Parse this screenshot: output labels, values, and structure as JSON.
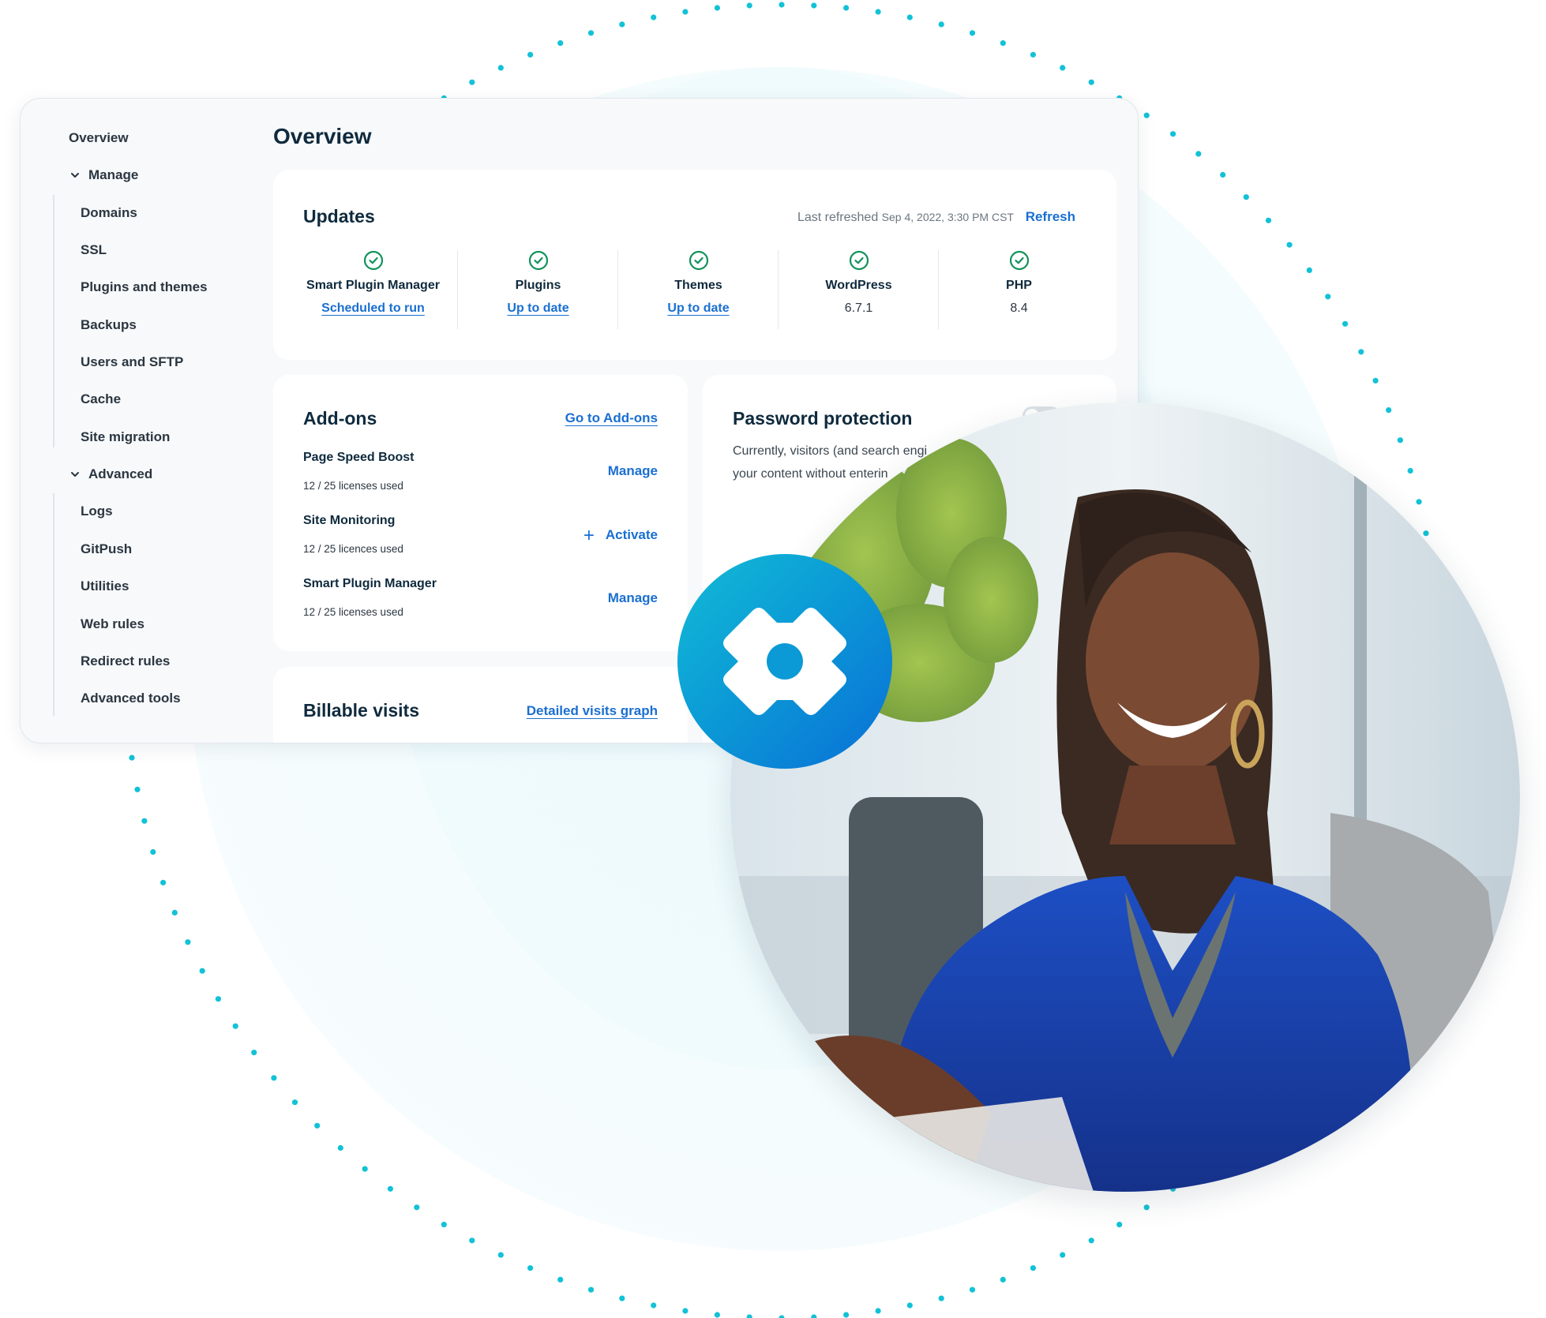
{
  "sidebar": {
    "overview": "Overview",
    "groups": [
      {
        "label": "Manage",
        "items": [
          "Domains",
          "SSL",
          "Plugins and themes",
          "Backups",
          "Users and SFTP",
          "Cache",
          "Site migration"
        ]
      },
      {
        "label": "Advanced",
        "items": [
          "Logs",
          "GitPush",
          "Utilities",
          "Web rules",
          "Redirect rules",
          "Advanced tools"
        ]
      }
    ]
  },
  "main": {
    "title": "Overview",
    "updates": {
      "title": "Updates",
      "last_refreshed_label": "Last refreshed",
      "last_refreshed_time": "Sep 4, 2022, 3:30 PM CST",
      "refresh_label": "Refresh",
      "items": [
        {
          "label": "Smart Plugin Manager",
          "value": "Scheduled to run",
          "is_link": true
        },
        {
          "label": "Plugins",
          "value": "Up to date",
          "is_link": true
        },
        {
          "label": "Themes",
          "value": "Up to date",
          "is_link": true
        },
        {
          "label": "WordPress",
          "value": "6.7.1",
          "is_link": false
        },
        {
          "label": "PHP",
          "value": "8.4",
          "is_link": false
        }
      ]
    },
    "addons": {
      "title": "Add-ons",
      "go_link": "Go to Add-ons",
      "items": [
        {
          "name": "Page Speed Boost",
          "usage": "12 / 25 licenses used",
          "action": "Manage"
        },
        {
          "name": "Site Monitoring",
          "usage": "12 / 25 licences used",
          "action": "Activate"
        },
        {
          "name": "Smart Plugin Manager",
          "usage": "12 / 25 licenses used",
          "action": "Manage"
        }
      ]
    },
    "password": {
      "title": "Password protection",
      "line1": "Currently, visitors (and search engi",
      "line2": "your content without enterin",
      "toggle_on": false
    },
    "billable": {
      "title": "Billable visits",
      "link": "Detailed visits graph"
    }
  },
  "icons": {
    "check": "check-circle-icon",
    "chevron": "chevron-down-icon",
    "plus": "plus-icon",
    "logo": "brand-logo-icon"
  },
  "colors": {
    "accent": "#1a6fd1",
    "success": "#11925a",
    "dots": "#12c2d6",
    "text": "#0f2a3d"
  }
}
